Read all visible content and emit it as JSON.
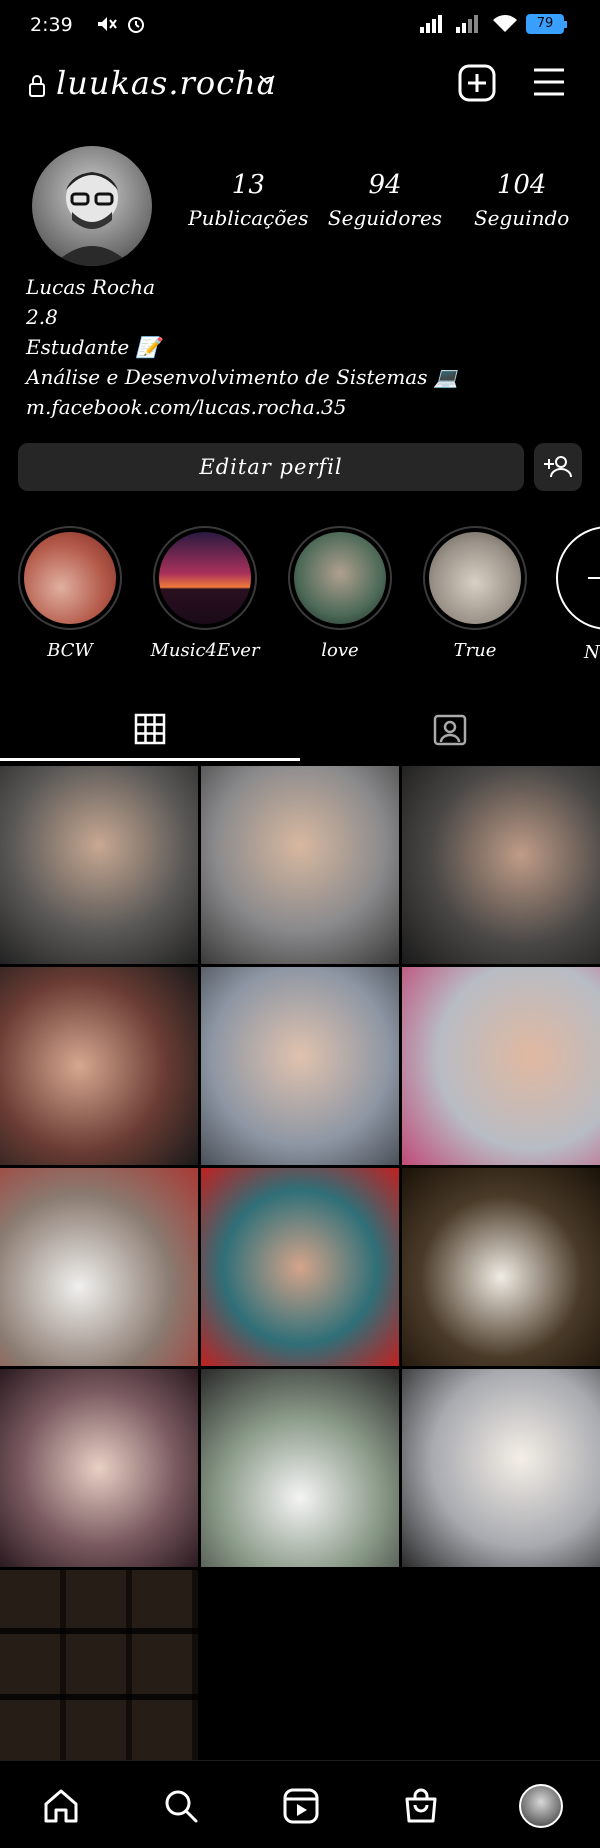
{
  "status": {
    "time": "2:39",
    "battery": "79"
  },
  "header": {
    "username": "luukas.rocha"
  },
  "profile": {
    "stats": [
      {
        "count": "13",
        "label": "Publicações"
      },
      {
        "count": "94",
        "label": "Seguidores"
      },
      {
        "count": "104",
        "label": "Seguindo"
      }
    ],
    "bio": {
      "name": "Lucas Rocha",
      "line2": "2.8",
      "line3": "Estudante 📝",
      "line4": "Análise e Desenvolvimento de Sistemas 💻",
      "link": "m.facebook.com/lucas.rocha.35"
    },
    "edit_label": "Editar perfil"
  },
  "highlights": [
    {
      "label": "BCW",
      "color": "#b45a4a"
    },
    {
      "label": "Music4Ever",
      "color": "#d8573a"
    },
    {
      "label": "love",
      "color": "#4e6a58"
    },
    {
      "label": "True",
      "color": "#9a9288"
    }
  ],
  "highlight_new_label": "Ne",
  "grid_colors": [
    "#5c5a58",
    "#8a8a8c",
    "#4a4846",
    "#6a3c34",
    "#8e97a4",
    "#b8bcc4",
    "#8a7a70",
    "#2f6f78",
    "#4a3a28",
    "#7a5a60",
    "#8a9a88",
    "#a8aab0",
    "#5a4e44"
  ]
}
